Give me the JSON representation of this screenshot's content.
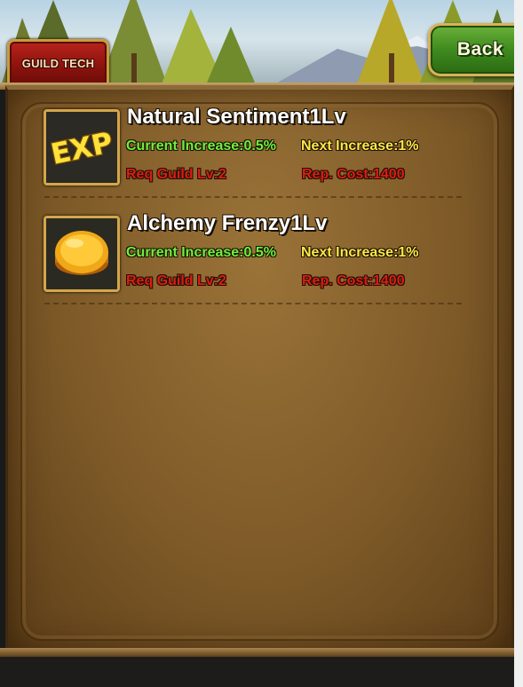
{
  "header": {
    "tab_label": "GUILD TECH",
    "back_label": "Back"
  },
  "techs": [
    {
      "title": "Natural Sentiment1Lv",
      "current": "Current Increase:0.5%",
      "next": "Next Increase:1%",
      "req": "Req Guild Lv:2",
      "cost": "Rep. Cost:1400",
      "icon": "exp-icon",
      "icon_text": "EXP"
    },
    {
      "title": "Alchemy Frenzy1Lv",
      "current": "Current Increase:0.5%",
      "next": "Next Increase:1%",
      "req": "Req Guild Lv:2",
      "cost": "Rep. Cost:1400",
      "icon": "gold-coin-icon"
    }
  ],
  "colors": {
    "current_text": "#6ef03a",
    "next_text": "#ffe845",
    "req_text": "#e21a12",
    "panel": "#7e5a28",
    "back_button": "#3f8a1f",
    "tab": "#8a120d"
  }
}
